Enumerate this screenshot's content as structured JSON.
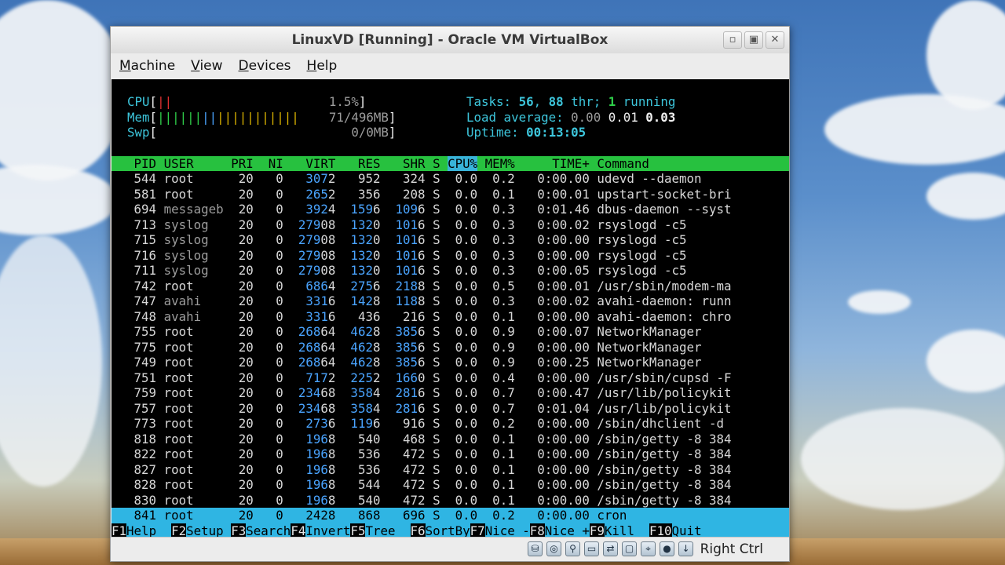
{
  "window": {
    "title": "LinuxVD [Running] - Oracle VM VirtualBox",
    "buttons": [
      "▫",
      "▣",
      "✕"
    ]
  },
  "menu": [
    {
      "label": "Machine",
      "u": "M",
      "rest": "achine"
    },
    {
      "label": "View",
      "u": "V",
      "rest": "iew"
    },
    {
      "label": "Devices",
      "u": "D",
      "rest": "evices"
    },
    {
      "label": "Help",
      "u": "H",
      "rest": "elp"
    }
  ],
  "htop": {
    "cpu": {
      "label": "CPU",
      "value": "1.5%"
    },
    "mem": {
      "label": "Mem",
      "value": "71/496MB"
    },
    "swp": {
      "label": "Swp",
      "value": "0/0MB"
    },
    "tasks": {
      "label": "Tasks:",
      "tasks": "56",
      "sep": ",",
      "threads": "88",
      "thr_label": "thr;",
      "running": "1",
      "running_label": "running"
    },
    "load": {
      "label": "Load average:",
      "l1": "0.00",
      "l5": "0.01",
      "l15": "0.03"
    },
    "uptime": {
      "label": "Uptime:",
      "value": "00:13:05"
    },
    "columns": [
      "PID",
      "USER",
      "PRI",
      "NI",
      "VIRT",
      "RES",
      "SHR",
      "S",
      "CPU%",
      "MEM%",
      "TIME+",
      "Command"
    ],
    "processes": [
      {
        "pid": "544",
        "user": "root",
        "pri": "20",
        "ni": "0",
        "virt": "3072",
        "res": "952",
        "shr": "324",
        "s": "S",
        "cpu": "0.0",
        "mem": "0.2",
        "time": "0:00.00",
        "cmd": "udevd --daemon"
      },
      {
        "pid": "581",
        "user": "root",
        "pri": "20",
        "ni": "0",
        "virt": "2652",
        "res": "356",
        "shr": "208",
        "s": "S",
        "cpu": "0.0",
        "mem": "0.1",
        "time": "0:00.01",
        "cmd": "upstart-socket-bri"
      },
      {
        "pid": "694",
        "user": "messageb",
        "pri": "20",
        "ni": "0",
        "virt": "3924",
        "res": "1596",
        "shr": "1096",
        "s": "S",
        "cpu": "0.0",
        "mem": "0.3",
        "time": "0:01.46",
        "cmd": "dbus-daemon --syst"
      },
      {
        "pid": "713",
        "user": "syslog",
        "pri": "20",
        "ni": "0",
        "virt": "27908",
        "res": "1320",
        "shr": "1016",
        "s": "S",
        "cpu": "0.0",
        "mem": "0.3",
        "time": "0:00.02",
        "cmd": "rsyslogd -c5"
      },
      {
        "pid": "715",
        "user": "syslog",
        "pri": "20",
        "ni": "0",
        "virt": "27908",
        "res": "1320",
        "shr": "1016",
        "s": "S",
        "cpu": "0.0",
        "mem": "0.3",
        "time": "0:00.00",
        "cmd": "rsyslogd -c5"
      },
      {
        "pid": "716",
        "user": "syslog",
        "pri": "20",
        "ni": "0",
        "virt": "27908",
        "res": "1320",
        "shr": "1016",
        "s": "S",
        "cpu": "0.0",
        "mem": "0.3",
        "time": "0:00.00",
        "cmd": "rsyslogd -c5"
      },
      {
        "pid": "711",
        "user": "syslog",
        "pri": "20",
        "ni": "0",
        "virt": "27908",
        "res": "1320",
        "shr": "1016",
        "s": "S",
        "cpu": "0.0",
        "mem": "0.3",
        "time": "0:00.05",
        "cmd": "rsyslogd -c5"
      },
      {
        "pid": "742",
        "user": "root",
        "pri": "20",
        "ni": "0",
        "virt": "6864",
        "res": "2756",
        "shr": "2188",
        "s": "S",
        "cpu": "0.0",
        "mem": "0.5",
        "time": "0:00.01",
        "cmd": "/usr/sbin/modem-ma"
      },
      {
        "pid": "747",
        "user": "avahi",
        "pri": "20",
        "ni": "0",
        "virt": "3316",
        "res": "1428",
        "shr": "1188",
        "s": "S",
        "cpu": "0.0",
        "mem": "0.3",
        "time": "0:00.02",
        "cmd": "avahi-daemon: runn"
      },
      {
        "pid": "748",
        "user": "avahi",
        "pri": "20",
        "ni": "0",
        "virt": "3316",
        "res": "436",
        "shr": "216",
        "s": "S",
        "cpu": "0.0",
        "mem": "0.1",
        "time": "0:00.00",
        "cmd": "avahi-daemon: chro"
      },
      {
        "pid": "755",
        "user": "root",
        "pri": "20",
        "ni": "0",
        "virt": "26864",
        "res": "4628",
        "shr": "3856",
        "s": "S",
        "cpu": "0.0",
        "mem": "0.9",
        "time": "0:00.07",
        "cmd": "NetworkManager"
      },
      {
        "pid": "775",
        "user": "root",
        "pri": "20",
        "ni": "0",
        "virt": "26864",
        "res": "4628",
        "shr": "3856",
        "s": "S",
        "cpu": "0.0",
        "mem": "0.9",
        "time": "0:00.00",
        "cmd": "NetworkManager"
      },
      {
        "pid": "749",
        "user": "root",
        "pri": "20",
        "ni": "0",
        "virt": "26864",
        "res": "4628",
        "shr": "3856",
        "s": "S",
        "cpu": "0.0",
        "mem": "0.9",
        "time": "0:00.25",
        "cmd": "NetworkManager"
      },
      {
        "pid": "751",
        "user": "root",
        "pri": "20",
        "ni": "0",
        "virt": "7172",
        "res": "2252",
        "shr": "1660",
        "s": "S",
        "cpu": "0.0",
        "mem": "0.4",
        "time": "0:00.00",
        "cmd": "/usr/sbin/cupsd -F"
      },
      {
        "pid": "759",
        "user": "root",
        "pri": "20",
        "ni": "0",
        "virt": "23468",
        "res": "3584",
        "shr": "2816",
        "s": "S",
        "cpu": "0.0",
        "mem": "0.7",
        "time": "0:00.47",
        "cmd": "/usr/lib/policykit"
      },
      {
        "pid": "757",
        "user": "root",
        "pri": "20",
        "ni": "0",
        "virt": "23468",
        "res": "3584",
        "shr": "2816",
        "s": "S",
        "cpu": "0.0",
        "mem": "0.7",
        "time": "0:01.04",
        "cmd": "/usr/lib/policykit"
      },
      {
        "pid": "773",
        "user": "root",
        "pri": "20",
        "ni": "0",
        "virt": "2736",
        "res": "1196",
        "shr": "916",
        "s": "S",
        "cpu": "0.0",
        "mem": "0.2",
        "time": "0:00.00",
        "cmd": "/sbin/dhclient -d"
      },
      {
        "pid": "818",
        "user": "root",
        "pri": "20",
        "ni": "0",
        "virt": "1968",
        "res": "540",
        "shr": "468",
        "s": "S",
        "cpu": "0.0",
        "mem": "0.1",
        "time": "0:00.00",
        "cmd": "/sbin/getty -8 384"
      },
      {
        "pid": "822",
        "user": "root",
        "pri": "20",
        "ni": "0",
        "virt": "1968",
        "res": "536",
        "shr": "472",
        "s": "S",
        "cpu": "0.0",
        "mem": "0.1",
        "time": "0:00.00",
        "cmd": "/sbin/getty -8 384"
      },
      {
        "pid": "827",
        "user": "root",
        "pri": "20",
        "ni": "0",
        "virt": "1968",
        "res": "536",
        "shr": "472",
        "s": "S",
        "cpu": "0.0",
        "mem": "0.1",
        "time": "0:00.00",
        "cmd": "/sbin/getty -8 384"
      },
      {
        "pid": "828",
        "user": "root",
        "pri": "20",
        "ni": "0",
        "virt": "1968",
        "res": "544",
        "shr": "472",
        "s": "S",
        "cpu": "0.0",
        "mem": "0.1",
        "time": "0:00.00",
        "cmd": "/sbin/getty -8 384"
      },
      {
        "pid": "830",
        "user": "root",
        "pri": "20",
        "ni": "0",
        "virt": "1968",
        "res": "540",
        "shr": "472",
        "s": "S",
        "cpu": "0.0",
        "mem": "0.1",
        "time": "0:00.00",
        "cmd": "/sbin/getty -8 384"
      },
      {
        "pid": "841",
        "user": "root",
        "pri": "20",
        "ni": "0",
        "virt": "2428",
        "res": "868",
        "shr": "696",
        "s": "S",
        "cpu": "0.0",
        "mem": "0.2",
        "time": "0:00.00",
        "cmd": "cron",
        "selected": true
      }
    ],
    "function_keys": [
      {
        "key": "F1",
        "label": "Help"
      },
      {
        "key": "F2",
        "label": "Setup"
      },
      {
        "key": "F3",
        "label": "Search"
      },
      {
        "key": "F4",
        "label": "Invert"
      },
      {
        "key": "F5",
        "label": "Tree"
      },
      {
        "key": "F6",
        "label": "SortBy"
      },
      {
        "key": "F7",
        "label": "Nice -"
      },
      {
        "key": "F8",
        "label": "Nice +"
      },
      {
        "key": "F9",
        "label": "Kill"
      },
      {
        "key": "F10",
        "label": "Quit"
      }
    ]
  },
  "statusbar": {
    "icons": [
      "hard-disk-icon",
      "optical-drive-icon",
      "usb-icon",
      "shared-folders-icon",
      "network-icon",
      "display-icon",
      "mouse-integration-icon",
      "recording-icon",
      "arrow-down-icon"
    ],
    "host_key": "Right Ctrl"
  },
  "colors": {
    "header_bg": "#27c13f",
    "selected_bg": "#2fb5e3",
    "cyan": "#3dc6dc"
  }
}
